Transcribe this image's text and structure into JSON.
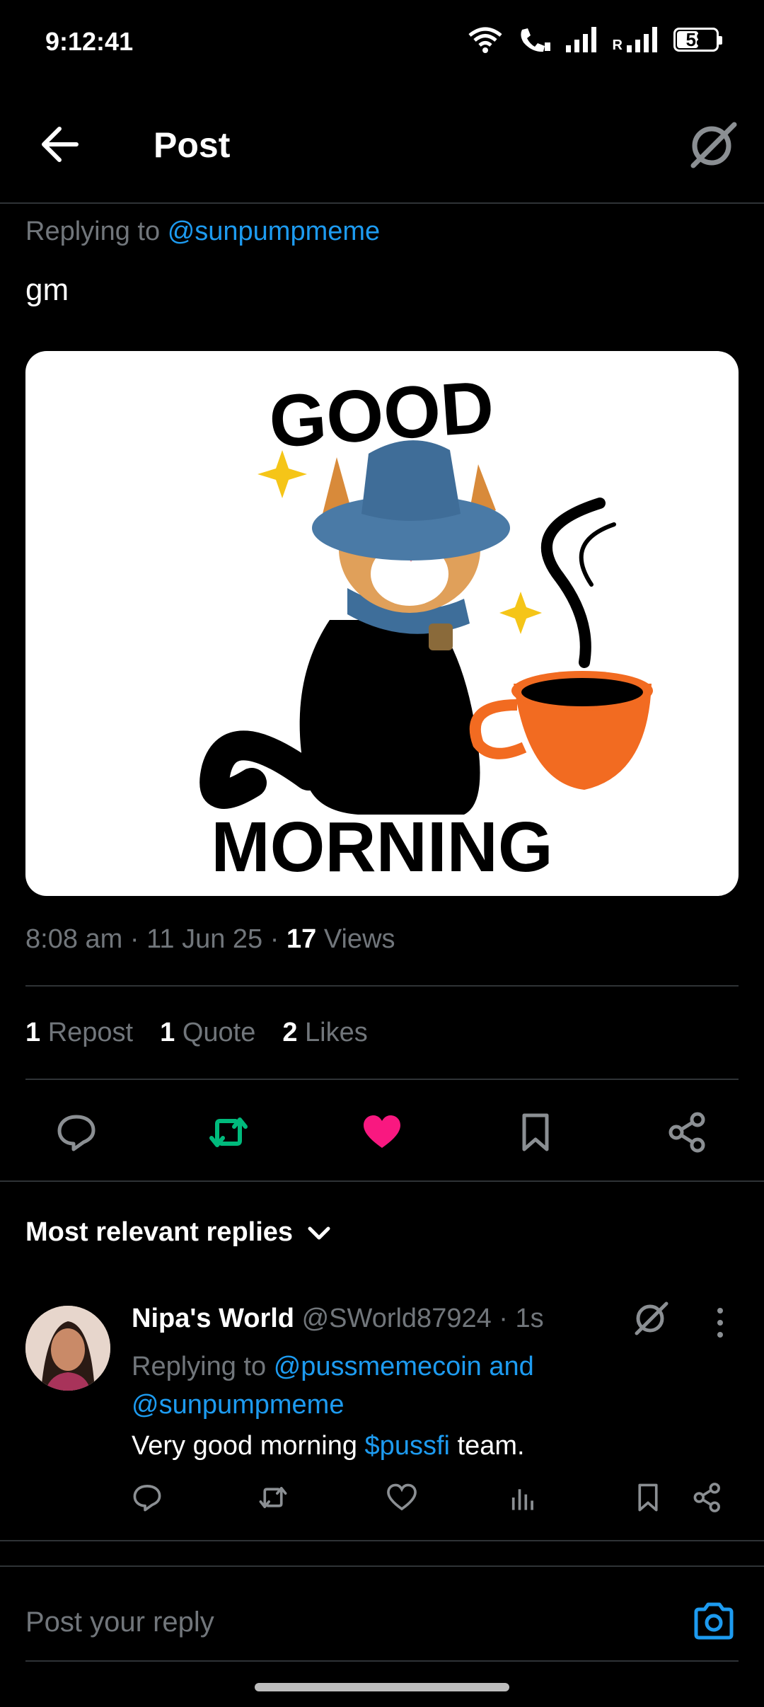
{
  "status_bar": {
    "time": "9:12:41",
    "battery": "58",
    "battery_level": 0.58,
    "roaming": "R"
  },
  "header": {
    "title": "Post"
  },
  "post": {
    "replying_prefix": "Replying to",
    "replying_handle": "@sunpumpmeme",
    "text": "gm",
    "image": {
      "top_text": "GOOD",
      "bottom_text": "MORNING"
    },
    "time": "8:08 am",
    "date": "11 Jun 25",
    "views_count": "17",
    "views_label": "Views",
    "stats": {
      "reposts_count": "1",
      "reposts_label": "Repost",
      "quotes_count": "1",
      "quotes_label": "Quote",
      "likes_count": "2",
      "likes_label": "Likes"
    }
  },
  "replies_section": {
    "sort_label": "Most relevant replies"
  },
  "reply": {
    "name": "Nipa's World",
    "handle": "@SWorld87924",
    "time": "1s",
    "replying_prefix": "Replying to",
    "replying_handles": "@pussmemecoin and @sunpumpmeme",
    "text_before": "Very good morning",
    "cashtag": "$pussfi",
    "text_after": "team."
  },
  "composer": {
    "placeholder": "Post your reply"
  },
  "colors": {
    "accent": "#1d9bf0",
    "repost": "#00ba7c",
    "like": "#f91880",
    "background": "#000000"
  }
}
